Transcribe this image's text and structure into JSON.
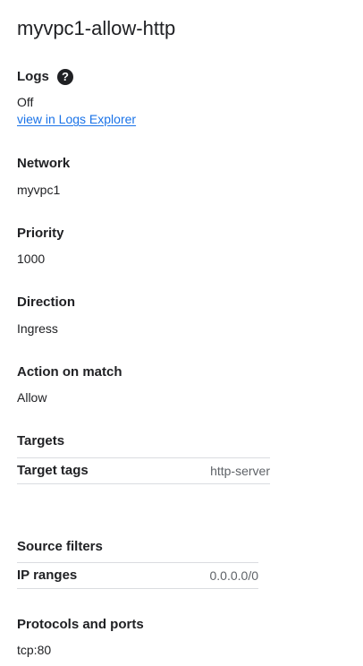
{
  "title": "myvpc1-allow-http",
  "logs": {
    "label": "Logs",
    "help_icon": "help-circle-icon",
    "help_glyph": "?",
    "value": "Off",
    "link": "view in Logs Explorer"
  },
  "network": {
    "label": "Network",
    "value": "myvpc1"
  },
  "priority": {
    "label": "Priority",
    "value": "1000"
  },
  "direction": {
    "label": "Direction",
    "value": "Ingress"
  },
  "action": {
    "label": "Action on match",
    "value": "Allow"
  },
  "targets": {
    "label": "Targets",
    "rows": [
      {
        "key": "Target tags",
        "value": "http-server"
      }
    ]
  },
  "source_filters": {
    "label": "Source filters",
    "rows": [
      {
        "key": "IP ranges",
        "value": "0.0.0.0/0"
      }
    ]
  },
  "protocols": {
    "label": "Protocols and ports",
    "value": "tcp:80"
  },
  "colors": {
    "text": "#202124",
    "link": "#1a73e8",
    "muted": "#5f6368",
    "divider": "#dadce0"
  }
}
